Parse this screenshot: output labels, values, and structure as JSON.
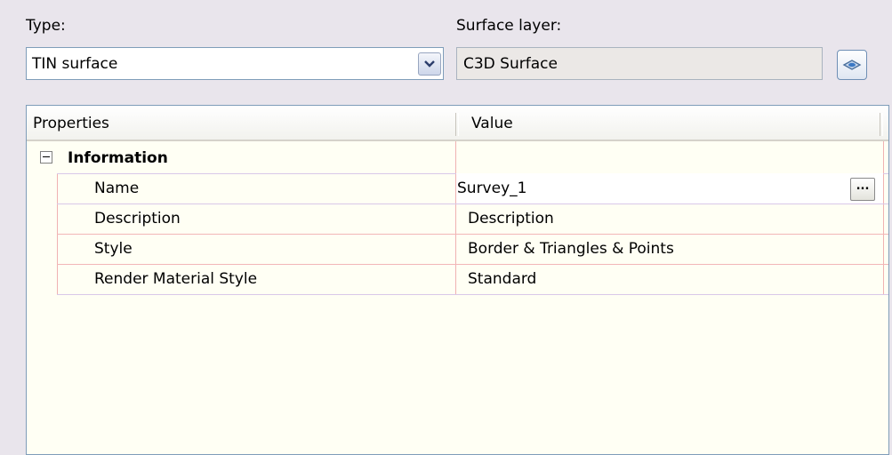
{
  "type": {
    "label": "Type:",
    "selected": "TIN surface",
    "dropdown_icon": "chevron-down-icon"
  },
  "surface_layer": {
    "label": "Surface layer:",
    "value": "C3D Surface",
    "pick_icon": "layer-pick-icon"
  },
  "grid": {
    "headers": {
      "properties": "Properties",
      "value": "Value"
    },
    "section": {
      "title": "Information",
      "expander_icon": "collapse-minus-icon"
    },
    "rows": [
      {
        "name": "Name",
        "value": "Survey_1",
        "button": "..."
      },
      {
        "name": "Description",
        "value": "Description"
      },
      {
        "name": "Style",
        "value": "Border & Triangles & Points"
      },
      {
        "name": "Render Material Style",
        "value": "Standard"
      }
    ]
  },
  "colors": {
    "background": "#e9e5ec",
    "grid_background": "#fffff4",
    "grid_line_purple": "#d9c8e8",
    "grid_line_pink": "#f0b2b2",
    "border_blue": "#7f9db9"
  }
}
